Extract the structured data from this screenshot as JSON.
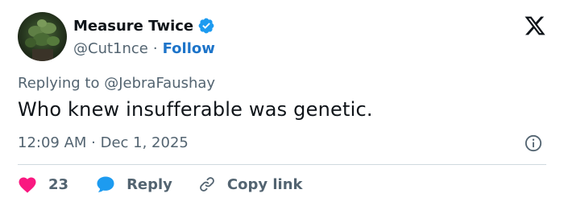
{
  "author": {
    "display_name": "Measure Twice",
    "handle": "@Cut1nce",
    "separator": "·",
    "follow_label": "Follow",
    "verified": true
  },
  "brand": {
    "logo": "x-logo-icon",
    "color": "#0f1419"
  },
  "tweet": {
    "reply_prefix": "Replying to",
    "reply_mention": "@JebraFaushay",
    "text": "Who knew insufferable was genetic.",
    "timestamp": "12:09 AM · Dec 1, 2025"
  },
  "actions": {
    "like_count": "23",
    "reply_label": "Reply",
    "copy_label": "Copy link"
  },
  "colors": {
    "accent": "#1d9bf0",
    "like": "#f91880",
    "muted": "#536471",
    "divider": "#cfd9de",
    "follow": "#1d74c9"
  }
}
